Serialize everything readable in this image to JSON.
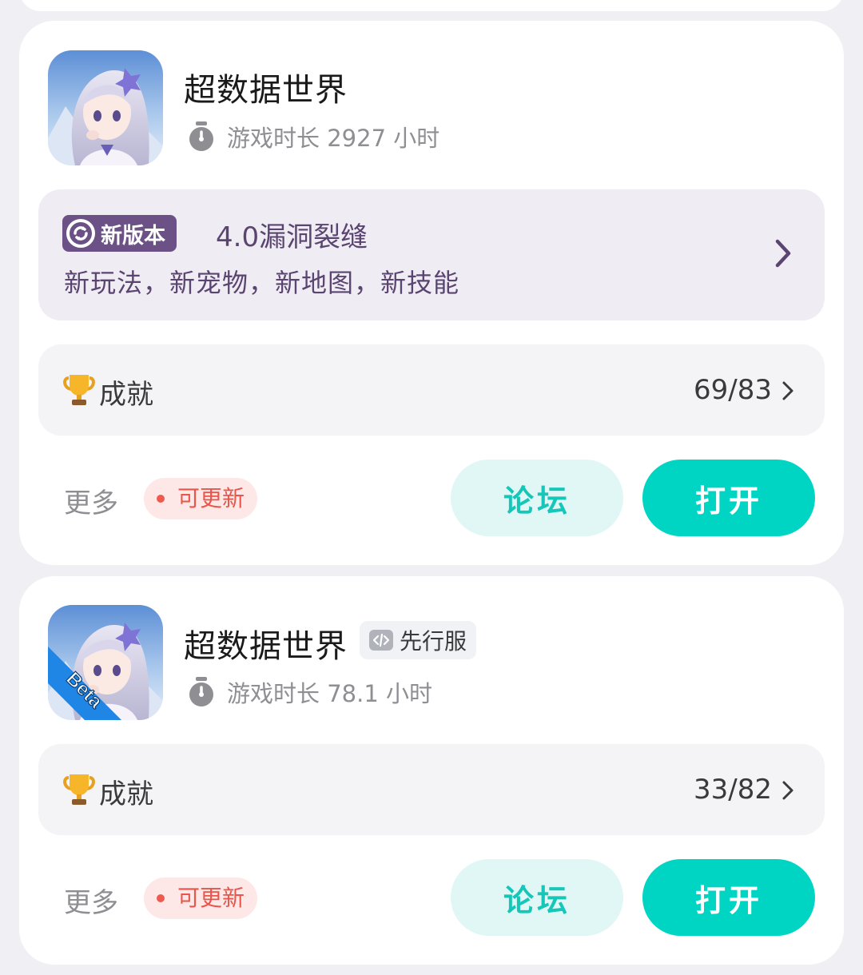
{
  "cards": [
    {
      "title": "超数据世界",
      "playtime_label": "游戏时长 2927 小时",
      "version": {
        "badge": "新版本",
        "name": "4.0漏洞裂缝",
        "desc": "新玩法，新宠物，新地图，新技能"
      },
      "achievement": {
        "label": "成就",
        "count": "69/83"
      },
      "more_label": "更多",
      "update_label": "可更新",
      "forum_label": "论坛",
      "open_label": "打开"
    },
    {
      "title": "超数据世界",
      "tag": "先行服",
      "icon_ribbon": "Beta",
      "playtime_label": "游戏时长 78.1 小时",
      "achievement": {
        "label": "成就",
        "count": "33/82"
      },
      "more_label": "更多",
      "update_label": "可更新",
      "forum_label": "论坛",
      "open_label": "打开"
    }
  ],
  "colors": {
    "accent": "#00d5c3",
    "accent_soft": "#e0f7f6",
    "version_bg": "#efecf4",
    "version_badge": "#6b5185",
    "update_red": "#e8554a"
  },
  "icons": {
    "playtime": "stopwatch-icon",
    "achievement": "trophy-icon",
    "version": "swirl-icon",
    "tag": "code-icon",
    "chevron": "chevron-right-icon"
  }
}
